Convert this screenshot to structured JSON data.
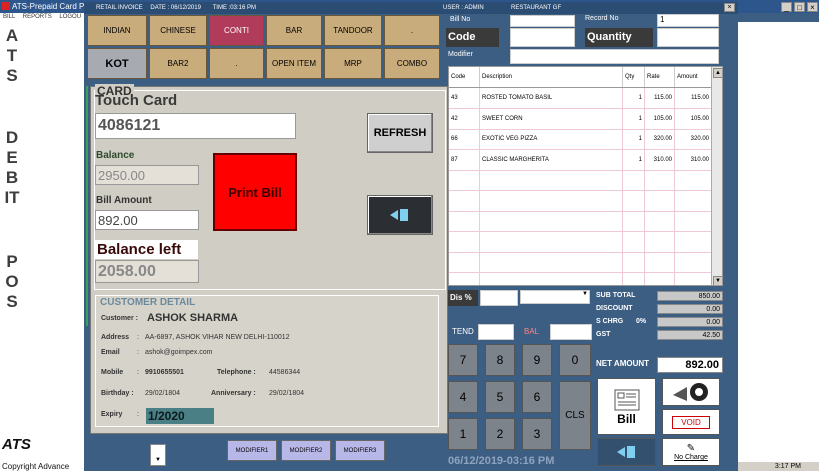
{
  "outer": {
    "title": "ATS-Prepaid Card P",
    "menu": [
      "BILL",
      "REPORTS",
      "LOGOU"
    ],
    "side_text_1": "ATS",
    "side_text_2": "DEBIT",
    "side_text_3": "POS",
    "logo": "ATS",
    "copyright": "Copyright Advance",
    "clock": "3:17 PM"
  },
  "inner": {
    "title": "RETAIL INVOICE",
    "date": "DATE : 06/12/2019",
    "time": "TIME :03:16 PM",
    "user": "USER : ADMIN",
    "restaurant": "RESTAURANT GF"
  },
  "categories": [
    "INDIAN",
    "CHINESE",
    "CONTI",
    "BAR",
    "TANDOOR",
    ".",
    "KOT",
    "BAR2",
    ".",
    "OPEN ITEM",
    "MRP",
    "COMBO"
  ],
  "header": {
    "bill_no_label": "Bill No",
    "record_no_label": "Record No",
    "record_no_value": "1",
    "code_label": "Code",
    "quantity_label": "Quantity",
    "modifier_label": "Modifier"
  },
  "table": {
    "columns": [
      "Code",
      "Description",
      "Qty",
      "Rate",
      "Amount"
    ],
    "rows": [
      [
        "43",
        "ROSTED TOMATO BASIL",
        "1",
        "115.00",
        "115.00"
      ],
      [
        "42",
        "SWEET CORN",
        "1",
        "105.00",
        "105.00"
      ],
      [
        "66",
        "EXOTIC VEG PIZZA",
        "1",
        "320.00",
        "320.00"
      ],
      [
        "87",
        "CLASSIC MARGHERITA",
        "1",
        "310.00",
        "310.00"
      ]
    ]
  },
  "summary": {
    "disc_label": "Dis %",
    "tend_label": "TEND",
    "bal_label": "BAL",
    "rows": [
      {
        "label": "SUB TOTAL",
        "value": "850.00"
      },
      {
        "label": "DISCOUNT",
        "value": "0.00"
      },
      {
        "label": "S CHRG",
        "pct": "0%",
        "value": "0.00"
      },
      {
        "label": "GST",
        "value": "42.50"
      }
    ],
    "net_label": "NET AMOUNT",
    "net_value": "892.00"
  },
  "keypad": [
    "7",
    "8",
    "9",
    "0",
    "4",
    "5",
    "6",
    "1",
    "2",
    "3"
  ],
  "keypad_cls": "CLS",
  "actions": {
    "bill": "Bill",
    "void": "VOID",
    "no_charge": "No Charge"
  },
  "footer_datetime": "06/12/2019-03:16 PM",
  "modifiers": [
    "MODIFIER1",
    "MODIFIER2",
    "MODIFIER3"
  ],
  "dialog": {
    "group_title": "CARD",
    "touch_card_label": "Touch Card",
    "touch_card_value": "4086121",
    "refresh_label": "REFRESH",
    "balance_label": "Balance",
    "balance_value": "2950.00",
    "bill_amount_label": "Bill  Amount",
    "bill_amount_value": "892.00",
    "print_bill_label": "Print Bill",
    "balance_left_label": "Balance left",
    "balance_left_value": "2058.00",
    "customer_title": "CUSTOMER DETAIL",
    "customer_label": "Customer :",
    "customer_name": "ASHOK SHARMA",
    "address_label": "Address",
    "address_value": "AA-6897, ASHOK VIHAR NEW DELHI-110012",
    "email_label": "Email",
    "email_value": "ashok@goimpex.com",
    "mobile_label": "Mobile",
    "mobile_value": "9910655501",
    "telephone_label": "Telephone :",
    "telephone_value": "44586344",
    "birthday_label": "Birthday :",
    "birthday_value": "29/02/1804",
    "anniversary_label": "Anniversary :",
    "anniversary_value": "29/02/1804",
    "expiry_label": "Expiry",
    "expiry_value": "1/2020"
  }
}
